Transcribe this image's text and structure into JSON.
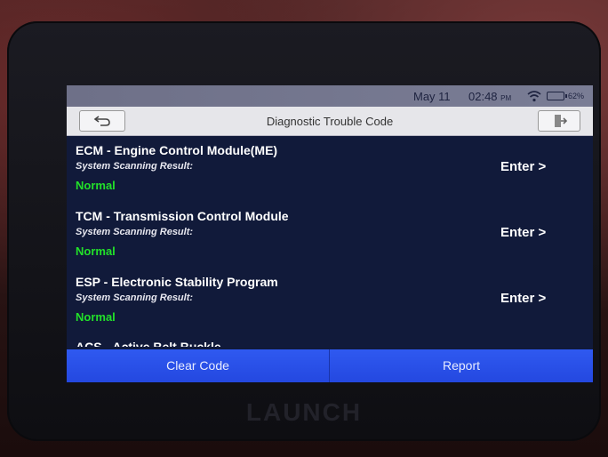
{
  "status": {
    "date": "May 11",
    "time": "02:48",
    "ampm": "PM",
    "battery": "62%"
  },
  "header": {
    "title": "Diagnostic Trouble Code"
  },
  "icons": {
    "back": "back-arrow-icon",
    "exit": "exit-icon",
    "wifi": "wifi-icon",
    "battery": "battery-icon"
  },
  "modules": [
    {
      "title": "ECM - Engine Control Module(ME)",
      "subtitle": "System Scanning Result:",
      "status": "Normal",
      "action": "Enter >"
    },
    {
      "title": "TCM - Transmission Control Module",
      "subtitle": "System Scanning Result:",
      "status": "Normal",
      "action": "Enter >"
    },
    {
      "title": "ESP - Electronic Stability Program",
      "subtitle": "System Scanning Result:",
      "status": "Normal",
      "action": "Enter >"
    },
    {
      "title": "ACS - Active Belt Buckle"
    }
  ],
  "footer": {
    "clear_label": "Clear Code",
    "report_label": "Report"
  },
  "device": {
    "brand": "LAUNCH"
  },
  "colors": {
    "status_normal": "#22e02a",
    "footer_blue": "#2f59f0",
    "screen_bg": "#111a3a"
  }
}
